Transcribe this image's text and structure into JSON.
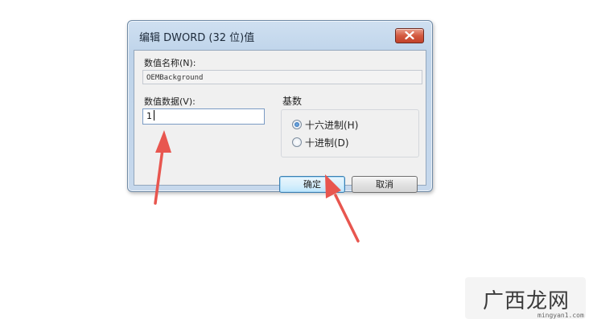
{
  "dialog": {
    "title": "编辑 DWORD (32 位)值",
    "value_name_label": "数值名称(N):",
    "value_name": "OEMBackground",
    "value_data_label": "数值数据(V):",
    "value_data": "1",
    "base": {
      "label": "基数",
      "options": [
        {
          "label": "十六进制(H)",
          "checked": true
        },
        {
          "label": "十进制(D)",
          "checked": false
        }
      ]
    },
    "ok_label": "确定",
    "cancel_label": "取消"
  },
  "watermark": {
    "text": "广西龙网",
    "url": "mingyan1.com"
  },
  "colors": {
    "arrow": "#e8564f",
    "titlebar": "#c6d8ec",
    "close_button": "#d35a40"
  },
  "icons": [
    "close-icon"
  ]
}
